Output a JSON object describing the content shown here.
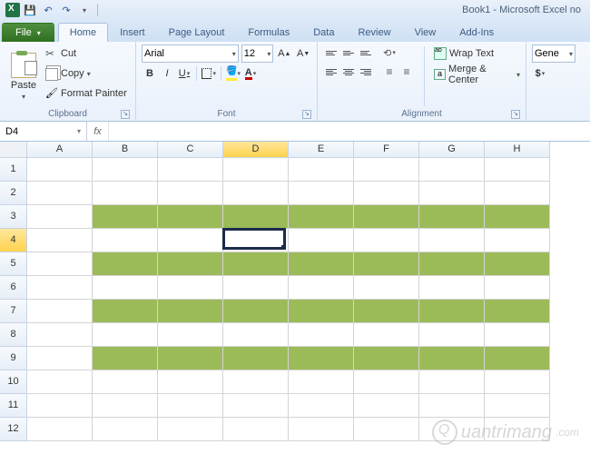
{
  "title": "Book1 - Microsoft Excel no",
  "tabs": {
    "file": "File",
    "home": "Home",
    "insert": "Insert",
    "page_layout": "Page Layout",
    "formulas": "Formulas",
    "data": "Data",
    "review": "Review",
    "view": "View",
    "addins": "Add-Ins"
  },
  "clipboard": {
    "paste": "Paste",
    "cut": "Cut",
    "copy": "Copy",
    "format_painter": "Format Painter",
    "label": "Clipboard"
  },
  "font": {
    "name": "Arial",
    "size": "12",
    "label": "Font",
    "bold": "B",
    "italic": "I",
    "underline": "U",
    "fontcolor_letter": "A"
  },
  "alignment": {
    "label": "Alignment",
    "wrap": "Wrap Text",
    "merge": "Merge & Center"
  },
  "number": {
    "general": "Gene",
    "dollar": "$"
  },
  "namebox": "D4",
  "fx": "fx",
  "formula": "",
  "columns": [
    "A",
    "B",
    "C",
    "D",
    "E",
    "F",
    "G",
    "H"
  ],
  "rows": [
    "1",
    "2",
    "3",
    "4",
    "5",
    "6",
    "7",
    "8",
    "9",
    "10",
    "11",
    "12"
  ],
  "green_rows": [
    3,
    5,
    7,
    9
  ],
  "green_col_start": 2,
  "green_col_end": 8,
  "active_cell": {
    "col": 4,
    "row": 4
  },
  "watermark": "uantrimang"
}
